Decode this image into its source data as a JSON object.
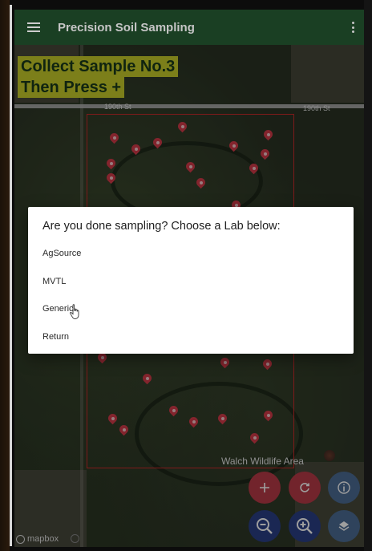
{
  "app_bar": {
    "title": "Precision Soil Sampling",
    "menu_icon": "hamburger-menu-icon",
    "overflow_icon": "more-vert-icon",
    "color": "#1f4a2a"
  },
  "map": {
    "instruction_line1": "Collect Sample No.3",
    "instruction_line2": "Then Press +",
    "road_label_left": "190th St",
    "road_label_right": "190th St",
    "area_label": "Walch Wildlife Area",
    "attribution": "mapbox",
    "boundary_color": "#cc2a2a",
    "marker_color": "#d43a4a",
    "marker_icon": "map-pin-icon"
  },
  "dialog": {
    "title": "Are you done sampling? Choose a Lab below:",
    "options": [
      "AgSource",
      "MVTL",
      "Generic",
      "Return"
    ]
  },
  "fabs": {
    "add_icon": "plus-icon",
    "refresh_icon": "refresh-icon",
    "info_icon": "info-icon",
    "zoom_out_icon": "zoom-out-icon",
    "zoom_in_icon": "zoom-in-icon",
    "layers_icon": "layers-icon",
    "red": "#b83a47",
    "blue": "#4c6c95",
    "navy": "#2b3f86"
  }
}
